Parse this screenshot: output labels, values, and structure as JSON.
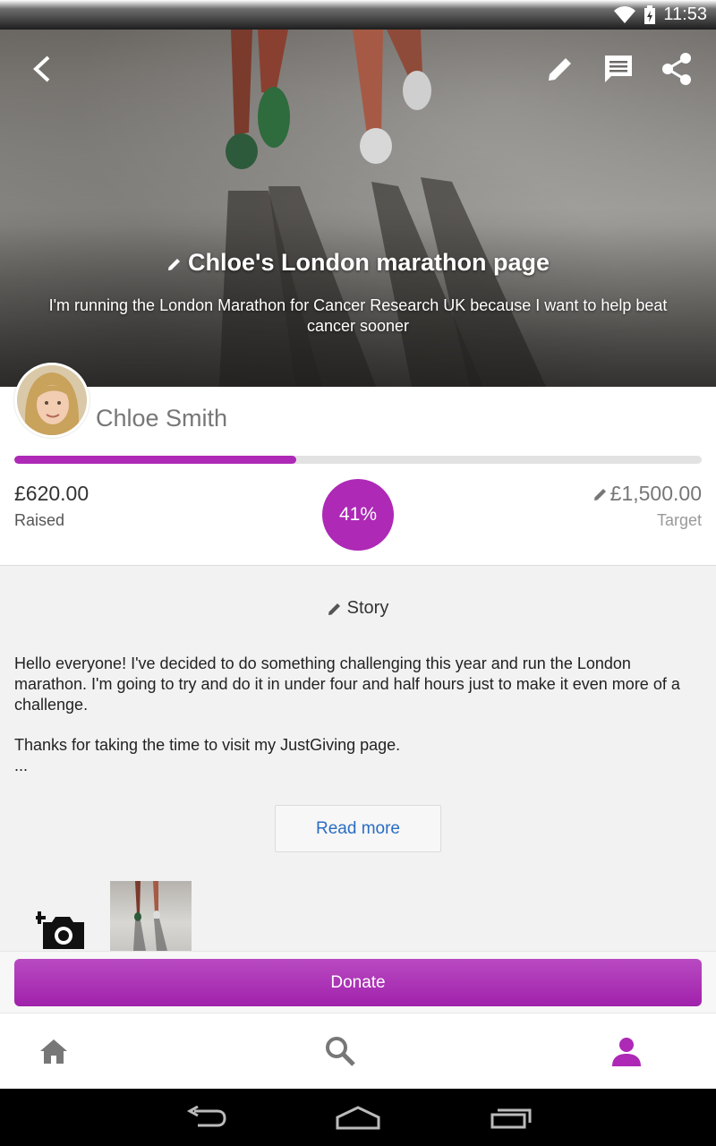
{
  "status_bar": {
    "time": "11:53"
  },
  "hero": {
    "title": "Chloe's London marathon page",
    "summary": "I'm running the London Marathon for Cancer Research UK because I want to help beat cancer sooner"
  },
  "profile": {
    "name": "Chloe Smith",
    "raised_amount": "£620.00",
    "raised_label": "Raised",
    "percent": "41%",
    "progress_fraction": 0.41,
    "target_amount": "£1,500.00",
    "target_label": "Target"
  },
  "story": {
    "heading": "Story",
    "paragraphs": [
      "Hello everyone! I've decided to do something challenging this year and run the London marathon. I'm going to try and do it in under four and half hours just to make it even more of a challenge.",
      "Thanks for taking the time to visit my JustGiving page."
    ],
    "ellipsis": "...",
    "read_more": "Read more"
  },
  "donate": {
    "label": "Donate"
  },
  "colors": {
    "accent": "#ad29b6",
    "link": "#2a6dc2"
  },
  "icons": {
    "top_bar": [
      "back-arrow-icon",
      "edit-icon",
      "comment-icon",
      "share-icon"
    ],
    "bottom_nav": [
      "home-icon",
      "search-icon",
      "profile-icon"
    ],
    "bottom_nav_active": "profile-icon"
  }
}
